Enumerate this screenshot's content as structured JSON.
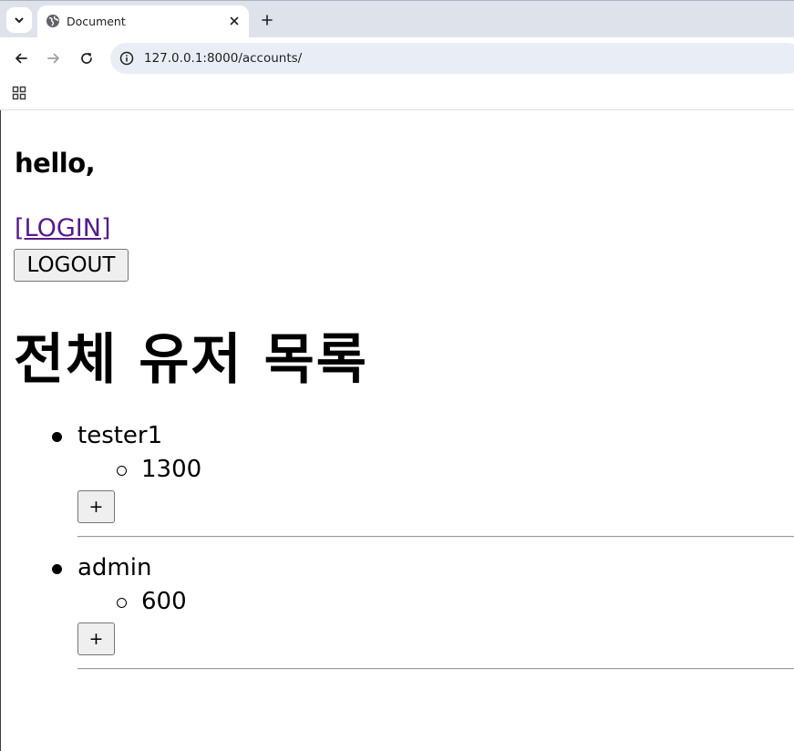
{
  "browser": {
    "tab": {
      "title": "Document"
    },
    "address_bar": {
      "url": "127.0.0.1:8000/accounts/"
    },
    "icons": {
      "tab_search": "chevron-down-icon",
      "favicon": "globe-icon",
      "tab_close": "close-icon",
      "new_tab": "plus-icon",
      "back": "arrow-left-icon",
      "forward": "arrow-right-icon",
      "reload": "reload-icon",
      "site_info": "info-icon",
      "apps": "apps-grid-icon"
    }
  },
  "page": {
    "greeting": "hello,",
    "login_link": "[LOGIN]",
    "logout_button": "LOGOUT",
    "heading": "전체 유저 목록",
    "users": [
      {
        "name": "tester1",
        "points": "1300",
        "add_button": "+"
      },
      {
        "name": "admin",
        "points": "600",
        "add_button": "+"
      }
    ]
  },
  "colors": {
    "link_visited": "#551a8b",
    "tabstrip_bg": "#dee3eb",
    "omnibox_bg": "#e9eef6",
    "button_bg": "#efefef"
  }
}
